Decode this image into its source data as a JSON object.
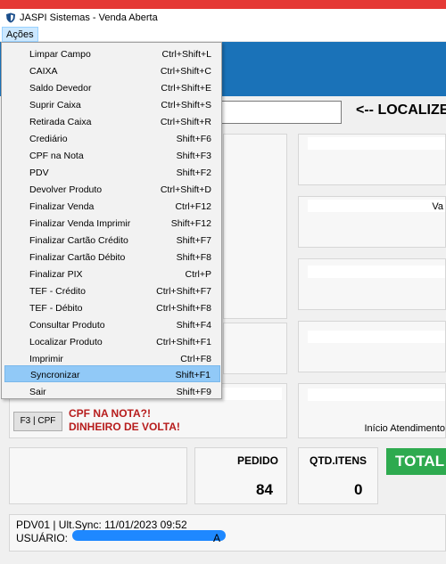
{
  "window": {
    "title": "JASPI Sistemas - Venda Aberta"
  },
  "menubar": {
    "acoes": "Ações"
  },
  "menu": [
    {
      "label": "Limpar Campo",
      "shortcut": "Ctrl+Shift+L"
    },
    {
      "label": "CAIXA",
      "shortcut": "Ctrl+Shift+C"
    },
    {
      "label": "Saldo Devedor",
      "shortcut": "Ctrl+Shift+E"
    },
    {
      "label": "Suprir Caixa",
      "shortcut": "Ctrl+Shift+S"
    },
    {
      "label": "Retirada Caixa",
      "shortcut": "Ctrl+Shift+R"
    },
    {
      "label": "Crediário",
      "shortcut": "Shift+F6"
    },
    {
      "label": "CPF na Nota",
      "shortcut": "Shift+F3"
    },
    {
      "label": "PDV",
      "shortcut": "Shift+F2"
    },
    {
      "label": "Devolver Produto",
      "shortcut": "Ctrl+Shift+D"
    },
    {
      "label": "Finalizar Venda",
      "shortcut": "Ctrl+F12"
    },
    {
      "label": "Finalizar Venda Imprimir",
      "shortcut": "Shift+F12"
    },
    {
      "label": "Finalizar Cartão Crédito",
      "shortcut": "Shift+F7"
    },
    {
      "label": "Finalizar Cartão Débito",
      "shortcut": "Shift+F8"
    },
    {
      "label": "Finalizar PIX",
      "shortcut": "Ctrl+P"
    },
    {
      "label": "TEF - Crédito",
      "shortcut": "Ctrl+Shift+F7"
    },
    {
      "label": "TEF - Débito",
      "shortcut": "Ctrl+Shift+F8"
    },
    {
      "label": "Consultar Produto",
      "shortcut": "Shift+F4"
    },
    {
      "label": "Localizar Produto",
      "shortcut": "Ctrl+Shift+F1"
    },
    {
      "label": "Imprimir",
      "shortcut": "Ctrl+F8"
    },
    {
      "label": "Syncronizar",
      "shortcut": "Shift+F1",
      "selected": true
    },
    {
      "label": "Sair",
      "shortcut": "Shift+F9"
    }
  ],
  "search": {
    "hint": "<-- LOCALIZE"
  },
  "panels": {
    "partial_label": "Va",
    "atendimento": "Início Atendimento"
  },
  "cpf": {
    "button": "F3 | CPF",
    "promo_line1": "CPF NA NOTA?!",
    "promo_line2": "DINHEIRO DE VOLTA!"
  },
  "stats": {
    "pedido_label": "PEDIDO",
    "pedido_value": "84",
    "qtd_label": "QTD.ITENS",
    "qtd_value": "0",
    "total_label": "TOTAL"
  },
  "footer": {
    "line1": "PDV01 | Ult.Sync: 11/01/2023 09:52",
    "user_label": "USUÁRIO:",
    "user_suffix": "A"
  },
  "colors": {
    "accent_blue": "#1a72b8",
    "total_green": "#2eaa4f",
    "promo_red": "#b71c1c",
    "menu_highlight": "#91c9f7"
  }
}
